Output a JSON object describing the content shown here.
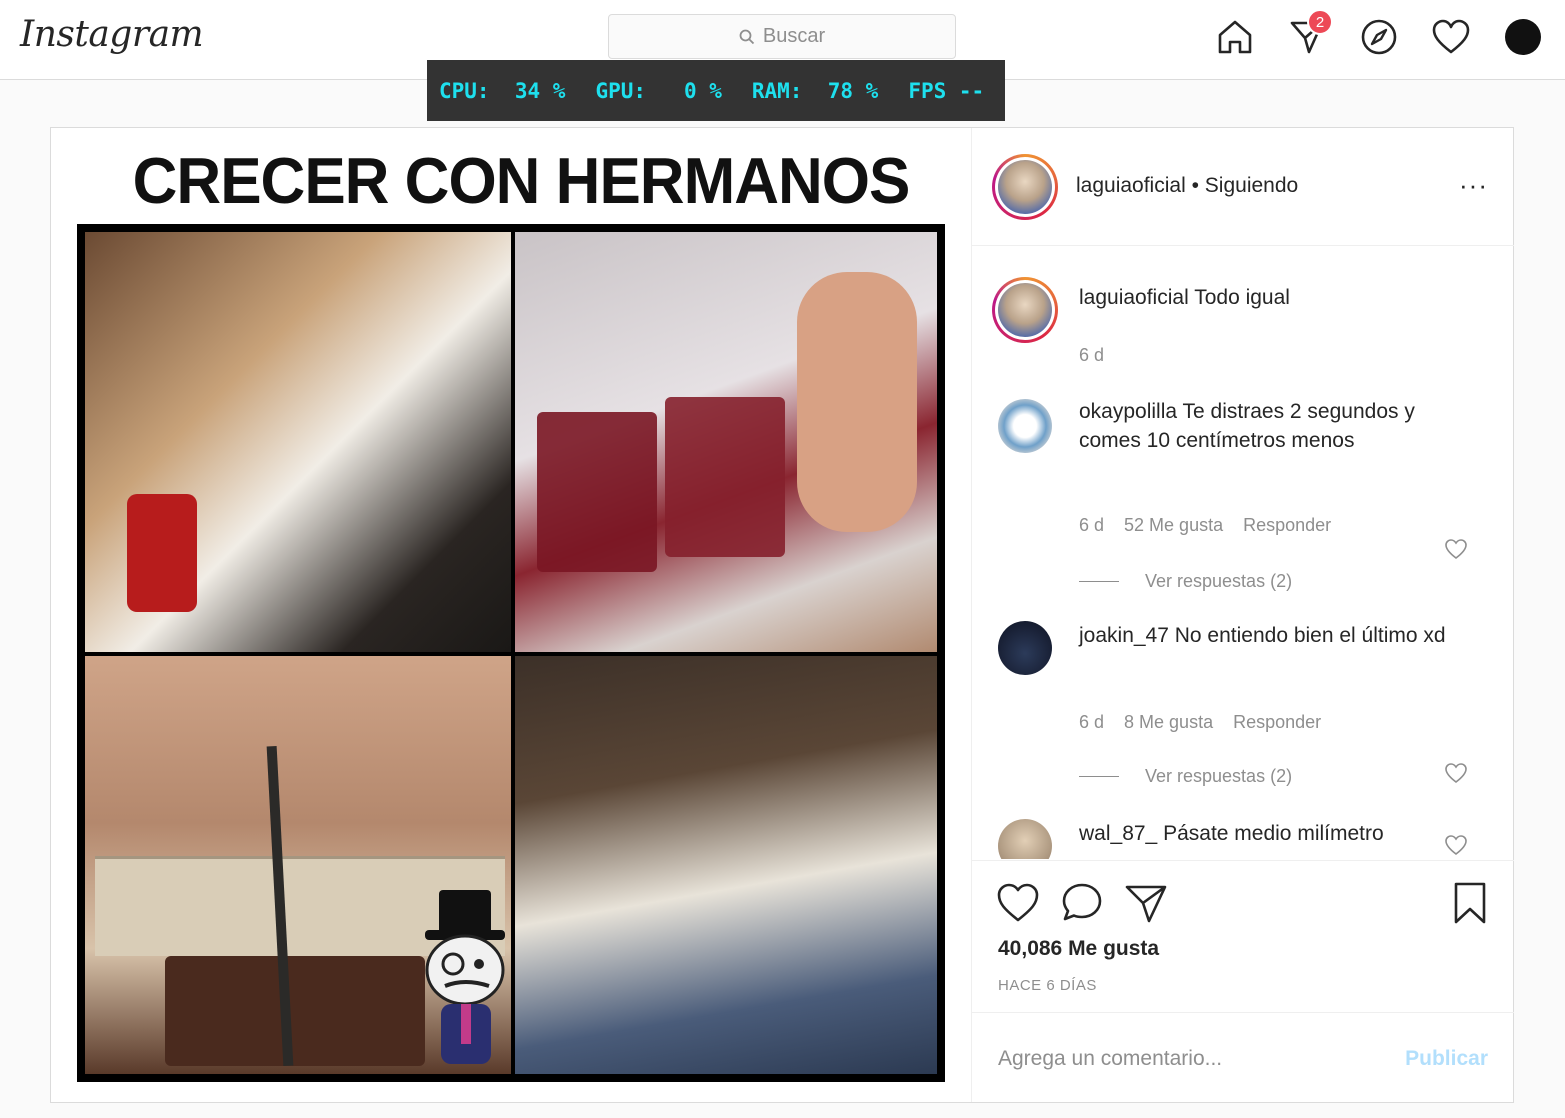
{
  "app": {
    "logo_text": "Instagram"
  },
  "search": {
    "placeholder": "Buscar"
  },
  "nav": {
    "direct_badge": "2"
  },
  "perf_overlay": {
    "cpu": "CPU:  34 %",
    "gpu": "GPU:   0 %",
    "ram": "RAM:  78 %",
    "fps": "FPS --"
  },
  "post": {
    "meme_title": "CRECER CON HERMANOS",
    "author": "laguiaoficial",
    "follow_status": "Siguiendo",
    "separator": "•",
    "more_label": "···",
    "caption": {
      "user": "laguiaoficial",
      "text": "Todo igual",
      "time": "6 d"
    },
    "comments": [
      {
        "user": "okaypolilla",
        "text": "Te distraes 2 segundos y comes 10 centímetros menos",
        "time": "6 d",
        "likes": "52 Me gusta",
        "reply": "Responder",
        "view_replies": "Ver respuestas (2)"
      },
      {
        "user": "joakin_47",
        "text": "No entiendo bien el último xd",
        "time": "6 d",
        "likes": "8 Me gusta",
        "reply": "Responder",
        "view_replies": "Ver respuestas (2)"
      },
      {
        "user": "wal_87_",
        "text": "Pásate medio milímetro"
      }
    ],
    "like_count": "40,086 Me gusta",
    "posted_ago": "HACE 6 DÍAS",
    "comment_placeholder": "Agrega un comentario...",
    "publish_label": "Publicar"
  },
  "colors": {
    "badge": "#ed4956",
    "publish_disabled": "#b2dffc",
    "overlay_text": "#1ee0ee"
  }
}
